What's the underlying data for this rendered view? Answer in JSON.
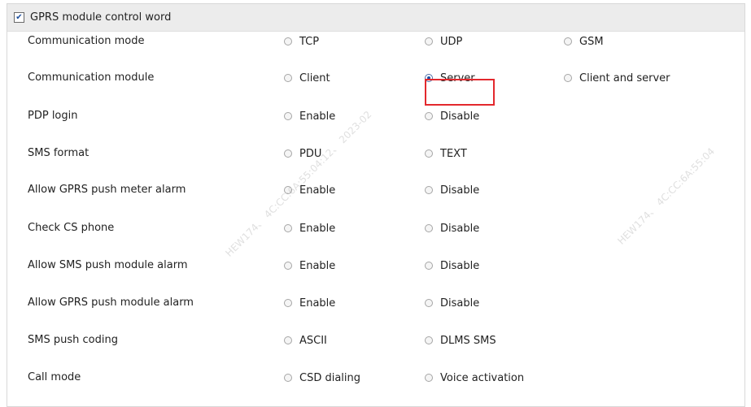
{
  "group": {
    "title": "GPRS module control word",
    "checked": true
  },
  "rows": [
    {
      "label": "Communication mode",
      "options": [
        {
          "label": "TCP",
          "selected": false
        },
        {
          "label": "UDP",
          "selected": false
        },
        {
          "label": "GSM",
          "selected": false
        }
      ]
    },
    {
      "label": "Communication module",
      "options": [
        {
          "label": "Client",
          "selected": false
        },
        {
          "label": "Server",
          "selected": true
        },
        {
          "label": "Client and server",
          "selected": false
        }
      ]
    },
    {
      "label": "PDP login",
      "options": [
        {
          "label": "Enable",
          "selected": false
        },
        {
          "label": "Disable",
          "selected": false
        }
      ]
    },
    {
      "label": "SMS format",
      "options": [
        {
          "label": "PDU",
          "selected": false
        },
        {
          "label": "TEXT",
          "selected": false
        }
      ]
    },
    {
      "label": "Allow GPRS push meter alarm",
      "options": [
        {
          "label": "Enable",
          "selected": false
        },
        {
          "label": "Disable",
          "selected": false
        }
      ]
    },
    {
      "label": "Check CS phone",
      "options": [
        {
          "label": "Enable",
          "selected": false
        },
        {
          "label": "Disable",
          "selected": false
        }
      ]
    },
    {
      "label": "Allow SMS push module alarm",
      "options": [
        {
          "label": "Enable",
          "selected": false
        },
        {
          "label": "Disable",
          "selected": false
        }
      ]
    },
    {
      "label": "Allow GPRS push module alarm",
      "options": [
        {
          "label": "Enable",
          "selected": false
        },
        {
          "label": "Disable",
          "selected": false
        }
      ]
    },
    {
      "label": "SMS push coding",
      "options": [
        {
          "label": "ASCII",
          "selected": false
        },
        {
          "label": "DLMS SMS",
          "selected": false
        }
      ]
    },
    {
      "label": "Call mode",
      "options": [
        {
          "label": "CSD dialing",
          "selected": false
        },
        {
          "label": "Voice activation",
          "selected": false
        }
      ]
    }
  ],
  "watermarks": [
    "HEW174、 4C:CC:6A:55:04:12、 2023-02",
    "HEW174、 4C:CC:6A:55:04"
  ],
  "colors": {
    "highlight": "#e3282d",
    "header_bg": "#ececec"
  }
}
